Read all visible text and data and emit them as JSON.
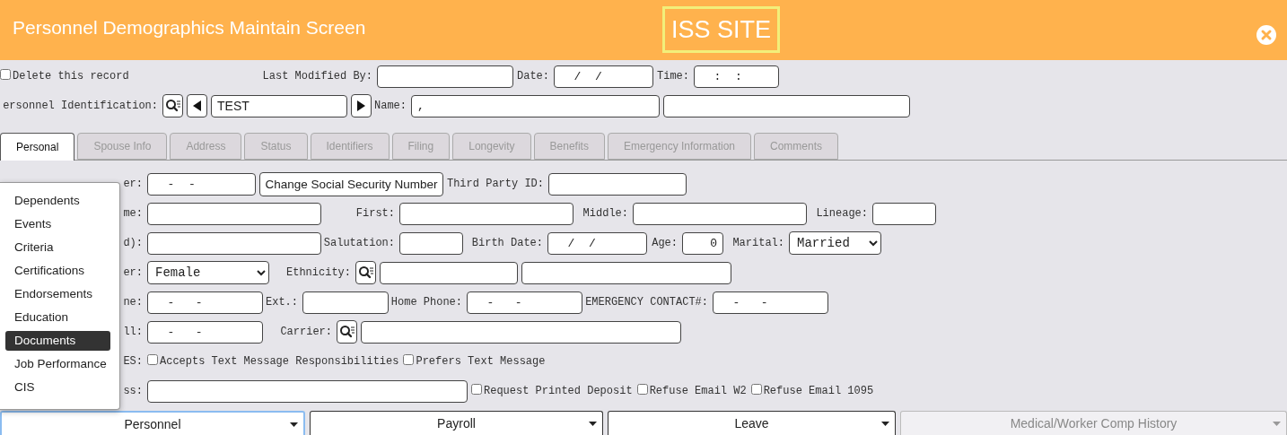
{
  "header": {
    "title": "Personnel Demographics Maintain Screen",
    "site": "ISS SITE"
  },
  "top_rows": [
    {
      "items": [
        {
          "kind": "checkbox",
          "label": "Delete this record",
          "checked": false
        },
        {
          "kind": "label",
          "text": "Last Modified By:"
        },
        {
          "kind": "input"
        },
        {
          "kind": "label",
          "text": "Date:"
        },
        {
          "kind": "input",
          "value": "  /  /"
        },
        {
          "kind": "label",
          "text": "Time:"
        },
        {
          "kind": "input",
          "value": "  :  :"
        }
      ]
    },
    {
      "items": [
        {
          "kind": "label",
          "text": "ersonnel Identification:"
        },
        {
          "kind": "lookup"
        },
        {
          "kind": "prev"
        },
        {
          "kind": "input",
          "value": "TEST"
        },
        {
          "kind": "next"
        },
        {
          "kind": "label",
          "text": "Name:"
        },
        {
          "kind": "input",
          "value": ","
        },
        {
          "kind": "input"
        }
      ]
    }
  ],
  "tabs": [
    {
      "label": "Personal",
      "selected": true
    },
    {
      "label": "Spouse Info",
      "selected": false
    },
    {
      "label": "Address",
      "selected": false
    },
    {
      "label": "Status",
      "selected": false
    },
    {
      "label": "Identifiers",
      "selected": false
    },
    {
      "label": "Filing",
      "selected": false
    },
    {
      "label": "Longevity",
      "selected": false
    },
    {
      "label": "Benefits",
      "selected": false
    },
    {
      "label": "Emergency Information",
      "selected": false
    },
    {
      "label": "Comments",
      "selected": false
    }
  ],
  "form_rows": [
    {
      "items": [
        {
          "kind": "label",
          "text": "er:"
        },
        {
          "kind": "input",
          "value": "  -  -"
        },
        {
          "kind": "button",
          "text": "Change Social Security Number"
        },
        {
          "kind": "label",
          "text": "Third Party ID:"
        },
        {
          "kind": "input"
        }
      ]
    },
    {
      "items": [
        {
          "kind": "label",
          "text": "me:"
        },
        {
          "kind": "input"
        },
        {
          "kind": "label",
          "text": "First:"
        },
        {
          "kind": "input"
        },
        {
          "kind": "label",
          "text": "Middle:"
        },
        {
          "kind": "input"
        },
        {
          "kind": "label",
          "text": "Lineage:"
        },
        {
          "kind": "input"
        }
      ]
    },
    {
      "items": [
        {
          "kind": "label",
          "text": "d):"
        },
        {
          "kind": "input"
        },
        {
          "kind": "label",
          "text": "Salutation:"
        },
        {
          "kind": "input"
        },
        {
          "kind": "label",
          "text": "Birth Date:"
        },
        {
          "kind": "input",
          "value": "  /  /"
        },
        {
          "kind": "label",
          "text": "Age:"
        },
        {
          "kind": "input",
          "value": "0"
        },
        {
          "kind": "label",
          "text": "Marital:"
        },
        {
          "kind": "select",
          "value": "Married"
        }
      ]
    },
    {
      "items": [
        {
          "kind": "label",
          "text": "er:"
        },
        {
          "kind": "select",
          "value": "Female"
        },
        {
          "kind": "label",
          "text": "Ethnicity:"
        },
        {
          "kind": "lookup"
        },
        {
          "kind": "input"
        },
        {
          "kind": "input"
        }
      ]
    },
    {
      "items": [
        {
          "kind": "label",
          "text": "ne:"
        },
        {
          "kind": "input",
          "value": "  -   -"
        },
        {
          "kind": "label",
          "text": "Ext.:"
        },
        {
          "kind": "input"
        },
        {
          "kind": "label",
          "text": "Home Phone:"
        },
        {
          "kind": "input",
          "value": "  -   -"
        },
        {
          "kind": "label",
          "text": "EMERGENCY CONTACT#:"
        },
        {
          "kind": "input",
          "value": "  -   -"
        }
      ]
    },
    {
      "items": [
        {
          "kind": "label",
          "text": "ll:"
        },
        {
          "kind": "input",
          "value": "  -   -"
        },
        {
          "kind": "label",
          "text": "Carrier:"
        },
        {
          "kind": "lookup"
        },
        {
          "kind": "input"
        }
      ]
    },
    {
      "items": [
        {
          "kind": "label",
          "text": "ES:"
        },
        {
          "kind": "checkbox",
          "label": "Accepts Text Message Responsibilities",
          "checked": false
        },
        {
          "kind": "checkbox",
          "label": "Prefers Text Message",
          "checked": false
        }
      ]
    },
    {
      "items": [
        {
          "kind": "label",
          "text": "ss:"
        },
        {
          "kind": "input"
        },
        {
          "kind": "checkbox",
          "label": "Request Printed Deposit",
          "checked": false
        },
        {
          "kind": "checkbox",
          "label": "Refuse Email W2",
          "checked": false
        },
        {
          "kind": "checkbox",
          "label": "Refuse Email 1095",
          "checked": false
        }
      ]
    }
  ],
  "menu": {
    "items": [
      {
        "label": "Dependents",
        "selected": false
      },
      {
        "label": "Events",
        "selected": false
      },
      {
        "label": "Criteria",
        "selected": false
      },
      {
        "label": "Certifications",
        "selected": false
      },
      {
        "label": "Endorsements",
        "selected": false
      },
      {
        "label": "Education",
        "selected": false
      },
      {
        "label": "Documents",
        "selected": true
      },
      {
        "label": "Job Performance",
        "selected": false
      },
      {
        "label": "CIS",
        "selected": false
      }
    ]
  },
  "bottom_nav": [
    {
      "label": "Personnel",
      "focused": true,
      "disabled": false
    },
    {
      "label": "Payroll",
      "focused": false,
      "disabled": false
    },
    {
      "label": "Leave",
      "focused": false,
      "disabled": false
    },
    {
      "label": "Medical/Worker Comp History",
      "focused": false,
      "disabled": true
    }
  ]
}
